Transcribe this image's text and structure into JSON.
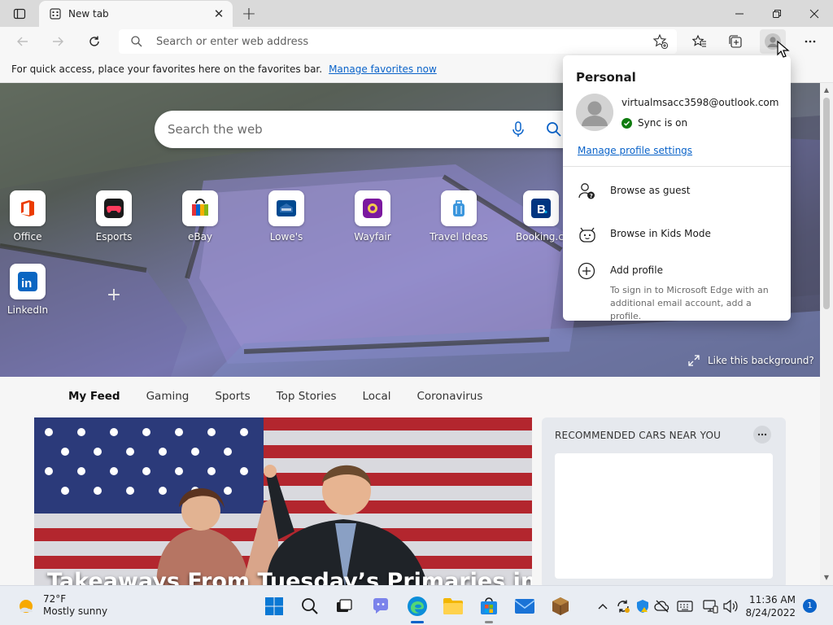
{
  "browser": {
    "tab_title": "New tab",
    "address_placeholder": "Search or enter web address"
  },
  "favorites_bar": {
    "message": "For quick access, place your favorites here on the favorites bar.",
    "link_label": "Manage favorites now"
  },
  "hero": {
    "search_placeholder": "Search the web",
    "like_background_label": "Like this background?",
    "quick_links": [
      {
        "label": "Office",
        "icon": "office-icon"
      },
      {
        "label": "Esports",
        "icon": "esports-icon"
      },
      {
        "label": "eBay",
        "icon": "ebay-icon"
      },
      {
        "label": "Lowe's",
        "icon": "lowes-icon"
      },
      {
        "label": "Wayfair",
        "icon": "wayfair-icon"
      },
      {
        "label": "Travel Ideas",
        "icon": "travel-ideas-icon"
      },
      {
        "label": "Booking.com",
        "icon": "booking-icon"
      },
      {
        "label": "LinkedIn",
        "icon": "linkedin-icon"
      }
    ]
  },
  "feed": {
    "tabs": [
      "My Feed",
      "Gaming",
      "Sports",
      "Top Stories",
      "Local",
      "Coronavirus"
    ],
    "active_tab": "My Feed",
    "main_headline": "Takeaways From Tuesday’s Primaries in",
    "side_card_title": "RECOMMENDED CARS NEAR YOU"
  },
  "profile_flyout": {
    "name": "Personal",
    "email": "virtualmsacc3598@outlook.com",
    "sync_status": "Sync is on",
    "manage_link": "Manage profile settings",
    "items": [
      {
        "label": "Browse as guest",
        "icon": "guest-icon"
      },
      {
        "label": "Browse in Kids Mode",
        "icon": "kids-mode-icon"
      },
      {
        "label": "Add profile",
        "icon": "add-profile-icon"
      }
    ],
    "add_profile_hint": "To sign in to Microsoft Edge with an additional email account, add a profile."
  },
  "taskbar": {
    "weather_temp": "72°F",
    "weather_desc": "Mostly sunny",
    "time": "11:36 AM",
    "date": "8/24/2022",
    "notification_count": "1"
  },
  "colors": {
    "accent": "#0a63c9",
    "sync_ok": "#107c10"
  }
}
